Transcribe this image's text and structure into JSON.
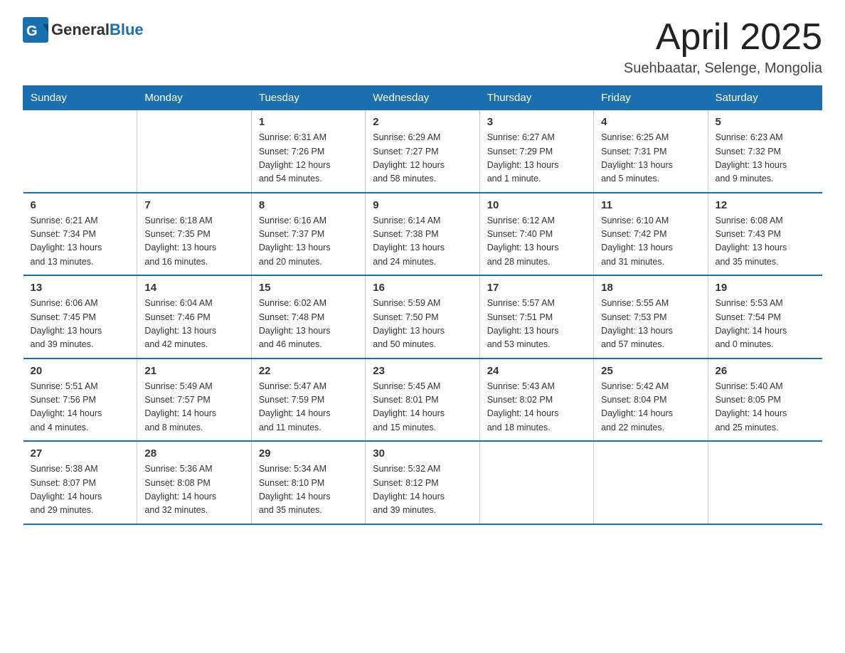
{
  "logo": {
    "general": "General",
    "blue": "Blue"
  },
  "header": {
    "month_year": "April 2025",
    "location": "Suehbaatar, Selenge, Mongolia"
  },
  "weekdays": [
    "Sunday",
    "Monday",
    "Tuesday",
    "Wednesday",
    "Thursday",
    "Friday",
    "Saturday"
  ],
  "weeks": [
    [
      {
        "day": "",
        "info": ""
      },
      {
        "day": "",
        "info": ""
      },
      {
        "day": "1",
        "info": "Sunrise: 6:31 AM\nSunset: 7:26 PM\nDaylight: 12 hours\nand 54 minutes."
      },
      {
        "day": "2",
        "info": "Sunrise: 6:29 AM\nSunset: 7:27 PM\nDaylight: 12 hours\nand 58 minutes."
      },
      {
        "day": "3",
        "info": "Sunrise: 6:27 AM\nSunset: 7:29 PM\nDaylight: 13 hours\nand 1 minute."
      },
      {
        "day": "4",
        "info": "Sunrise: 6:25 AM\nSunset: 7:31 PM\nDaylight: 13 hours\nand 5 minutes."
      },
      {
        "day": "5",
        "info": "Sunrise: 6:23 AM\nSunset: 7:32 PM\nDaylight: 13 hours\nand 9 minutes."
      }
    ],
    [
      {
        "day": "6",
        "info": "Sunrise: 6:21 AM\nSunset: 7:34 PM\nDaylight: 13 hours\nand 13 minutes."
      },
      {
        "day": "7",
        "info": "Sunrise: 6:18 AM\nSunset: 7:35 PM\nDaylight: 13 hours\nand 16 minutes."
      },
      {
        "day": "8",
        "info": "Sunrise: 6:16 AM\nSunset: 7:37 PM\nDaylight: 13 hours\nand 20 minutes."
      },
      {
        "day": "9",
        "info": "Sunrise: 6:14 AM\nSunset: 7:38 PM\nDaylight: 13 hours\nand 24 minutes."
      },
      {
        "day": "10",
        "info": "Sunrise: 6:12 AM\nSunset: 7:40 PM\nDaylight: 13 hours\nand 28 minutes."
      },
      {
        "day": "11",
        "info": "Sunrise: 6:10 AM\nSunset: 7:42 PM\nDaylight: 13 hours\nand 31 minutes."
      },
      {
        "day": "12",
        "info": "Sunrise: 6:08 AM\nSunset: 7:43 PM\nDaylight: 13 hours\nand 35 minutes."
      }
    ],
    [
      {
        "day": "13",
        "info": "Sunrise: 6:06 AM\nSunset: 7:45 PM\nDaylight: 13 hours\nand 39 minutes."
      },
      {
        "day": "14",
        "info": "Sunrise: 6:04 AM\nSunset: 7:46 PM\nDaylight: 13 hours\nand 42 minutes."
      },
      {
        "day": "15",
        "info": "Sunrise: 6:02 AM\nSunset: 7:48 PM\nDaylight: 13 hours\nand 46 minutes."
      },
      {
        "day": "16",
        "info": "Sunrise: 5:59 AM\nSunset: 7:50 PM\nDaylight: 13 hours\nand 50 minutes."
      },
      {
        "day": "17",
        "info": "Sunrise: 5:57 AM\nSunset: 7:51 PM\nDaylight: 13 hours\nand 53 minutes."
      },
      {
        "day": "18",
        "info": "Sunrise: 5:55 AM\nSunset: 7:53 PM\nDaylight: 13 hours\nand 57 minutes."
      },
      {
        "day": "19",
        "info": "Sunrise: 5:53 AM\nSunset: 7:54 PM\nDaylight: 14 hours\nand 0 minutes."
      }
    ],
    [
      {
        "day": "20",
        "info": "Sunrise: 5:51 AM\nSunset: 7:56 PM\nDaylight: 14 hours\nand 4 minutes."
      },
      {
        "day": "21",
        "info": "Sunrise: 5:49 AM\nSunset: 7:57 PM\nDaylight: 14 hours\nand 8 minutes."
      },
      {
        "day": "22",
        "info": "Sunrise: 5:47 AM\nSunset: 7:59 PM\nDaylight: 14 hours\nand 11 minutes."
      },
      {
        "day": "23",
        "info": "Sunrise: 5:45 AM\nSunset: 8:01 PM\nDaylight: 14 hours\nand 15 minutes."
      },
      {
        "day": "24",
        "info": "Sunrise: 5:43 AM\nSunset: 8:02 PM\nDaylight: 14 hours\nand 18 minutes."
      },
      {
        "day": "25",
        "info": "Sunrise: 5:42 AM\nSunset: 8:04 PM\nDaylight: 14 hours\nand 22 minutes."
      },
      {
        "day": "26",
        "info": "Sunrise: 5:40 AM\nSunset: 8:05 PM\nDaylight: 14 hours\nand 25 minutes."
      }
    ],
    [
      {
        "day": "27",
        "info": "Sunrise: 5:38 AM\nSunset: 8:07 PM\nDaylight: 14 hours\nand 29 minutes."
      },
      {
        "day": "28",
        "info": "Sunrise: 5:36 AM\nSunset: 8:08 PM\nDaylight: 14 hours\nand 32 minutes."
      },
      {
        "day": "29",
        "info": "Sunrise: 5:34 AM\nSunset: 8:10 PM\nDaylight: 14 hours\nand 35 minutes."
      },
      {
        "day": "30",
        "info": "Sunrise: 5:32 AM\nSunset: 8:12 PM\nDaylight: 14 hours\nand 39 minutes."
      },
      {
        "day": "",
        "info": ""
      },
      {
        "day": "",
        "info": ""
      },
      {
        "day": "",
        "info": ""
      }
    ]
  ]
}
